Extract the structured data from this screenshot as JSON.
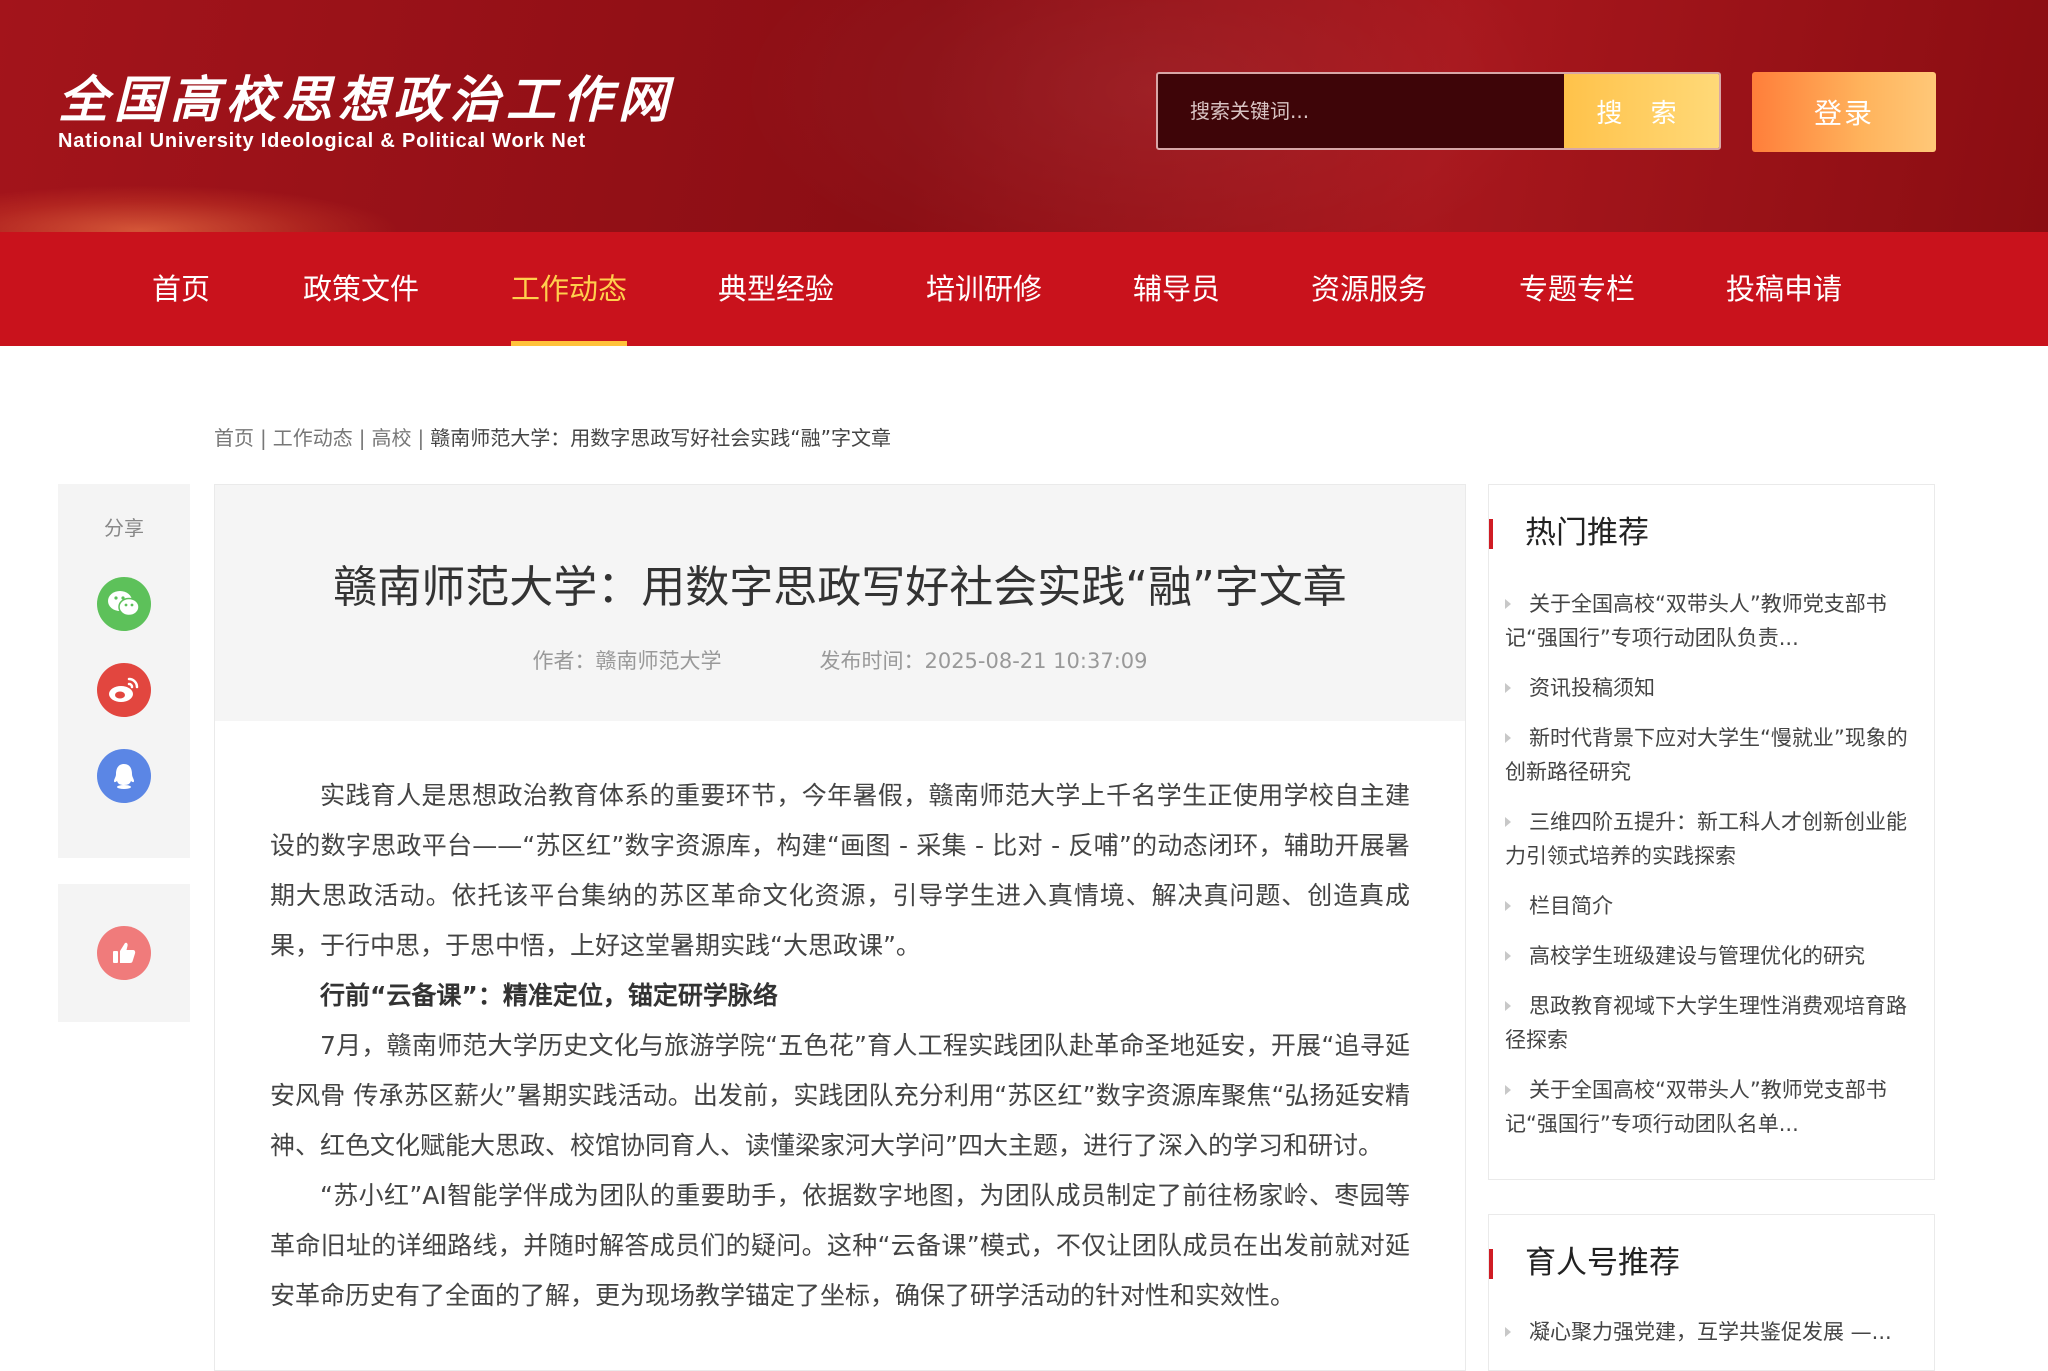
{
  "header": {
    "logo_cn": "全国高校思想政治工作网",
    "logo_en": "National University Ideological & Political Work Net",
    "search_placeholder": "搜索关键词...",
    "search_button": "搜 索",
    "login_button": "登录"
  },
  "nav": {
    "items": [
      {
        "label": "首页",
        "active": false
      },
      {
        "label": "政策文件",
        "active": false
      },
      {
        "label": "工作动态",
        "active": true
      },
      {
        "label": "典型经验",
        "active": false
      },
      {
        "label": "培训研修",
        "active": false
      },
      {
        "label": "辅导员",
        "active": false
      },
      {
        "label": "资源服务",
        "active": false
      },
      {
        "label": "专题专栏",
        "active": false
      },
      {
        "label": "投稿申请",
        "active": false
      }
    ]
  },
  "breadcrumb": {
    "items": [
      "首页",
      "工作动态",
      "高校"
    ],
    "separator": "|",
    "current": "赣南师范大学：用数字思政写好社会实践“融”字文章"
  },
  "share": {
    "label": "分享",
    "icons": [
      "wechat-icon",
      "weibo-icon",
      "qq-icon"
    ],
    "like_icon": "thumbs-up-icon",
    "colors": {
      "wechat": "#5dc15a",
      "weibo": "#e2463f",
      "qq": "#5b86e5",
      "like": "#f07b7b"
    }
  },
  "article": {
    "title": "赣南师范大学：用数字思政写好社会实践“融”字文章",
    "author_label": "作者：",
    "author": "赣南师范大学",
    "date_label": "发布时间：",
    "date": "2025-08-21 10:37:09",
    "paragraphs": [
      "实践育人是思想政治教育体系的重要环节，今年暑假，赣南师范大学上千名学生正使用学校自主建设的数字思政平台——“苏区红”数字资源库，构建“画图 - 采集 - 比对 - 反哺”的动态闭环，辅助开展暑期大思政活动。依托该平台集纳的苏区革命文化资源，引导学生进入真情境、解决真问题、创造真成果，于行中思，于思中悟，上好这堂暑期实践“大思政课”。",
      "行前“云备课”：精准定位，锚定研学脉络",
      "7月，赣南师范大学历史文化与旅游学院“五色花”育人工程实践团队赴革命圣地延安，开展“追寻延安风骨 传承苏区薪火”暑期实践活动。出发前，实践团队充分利用“苏区红”数字资源库聚焦“弘扬延安精神、红色文化赋能大思政、校馆协同育人、读懂梁家河大学问”四大主题，进行了深入的学习和研讨。",
      "“苏小红”AI智能学伴成为团队的重要助手，依据数字地图，为团队成员制定了前往杨家岭、枣园等革命旧址的详细路线，并随时解答成员们的疑问。这种“云备课”模式，不仅让团队成员在出发前就对延安革命历史有了全面的了解，更为现场教学锚定了坐标，确保了研学活动的针对性和实效性。"
    ]
  },
  "hot": {
    "title": "热门推荐",
    "items": [
      "关于全国高校“双带头人”教师党支部书记“强国行”专项行动团队负责...",
      "资讯投稿须知",
      "新时代背景下应对大学生“慢就业”现象的创新路径研究",
      "三维四阶五提升：新工科人才创新创业能力引领式培养的实践探索",
      "栏目简介",
      "高校学生班级建设与管理优化的研究",
      "思政教育视域下大学生理性消费观培育路径探索",
      "关于全国高校“双带头人”教师党支部书记“强国行”专项行动团队名单..."
    ]
  },
  "yuren": {
    "title": "育人号推荐",
    "items": [
      "凝心聚力强党建，互学共鉴促发展 —..."
    ]
  }
}
